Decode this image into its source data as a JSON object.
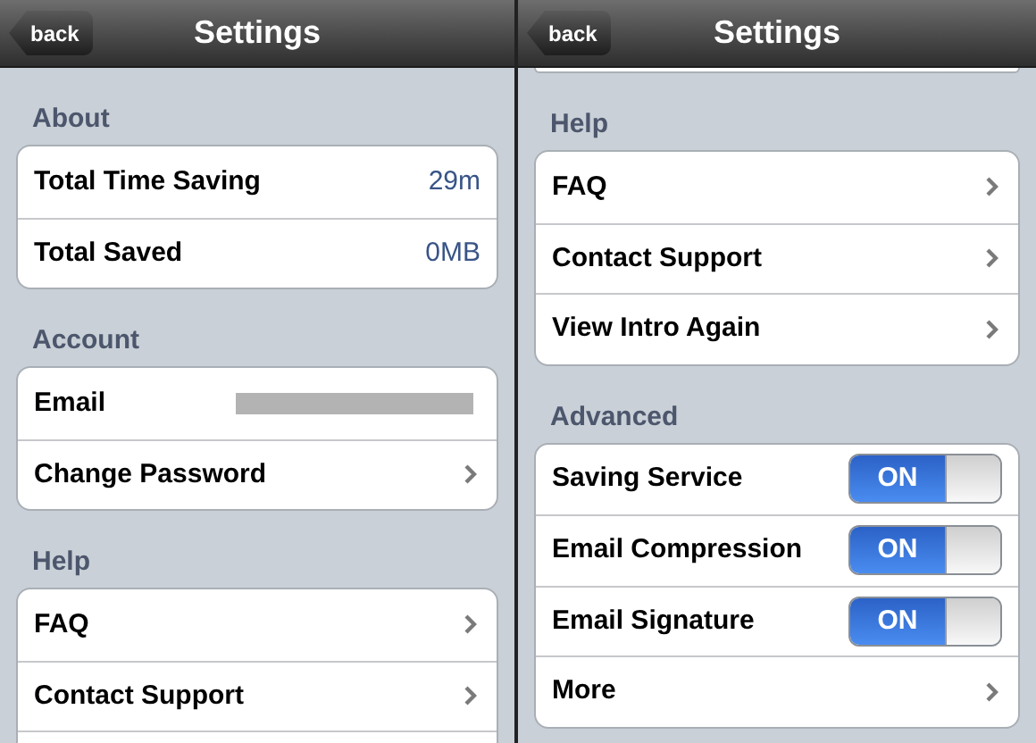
{
  "screens": [
    {
      "title": "Settings",
      "back": "back",
      "cut_group_above": false,
      "sections": [
        {
          "header": "About",
          "rows": [
            {
              "kind": "value",
              "label": "Total Time Saving",
              "value": "29m"
            },
            {
              "kind": "value",
              "label": "Total Saved",
              "value": "0MB"
            }
          ]
        },
        {
          "header": "Account",
          "rows": [
            {
              "kind": "redacted",
              "label": "Email"
            },
            {
              "kind": "link",
              "label": "Change Password"
            }
          ]
        },
        {
          "header": "Help",
          "rows": [
            {
              "kind": "link",
              "label": "FAQ"
            },
            {
              "kind": "link",
              "label": "Contact Support"
            },
            {
              "kind": "blank"
            }
          ]
        }
      ]
    },
    {
      "title": "Settings",
      "back": "back",
      "cut_group_above": true,
      "sections": [
        {
          "header": "Help",
          "rows": [
            {
              "kind": "link",
              "label": "FAQ"
            },
            {
              "kind": "link",
              "label": "Contact Support"
            },
            {
              "kind": "link",
              "label": "View Intro Again"
            }
          ]
        },
        {
          "header": "Advanced",
          "rows": [
            {
              "kind": "toggle",
              "label": "Saving Service",
              "on": true,
              "state_text": "ON"
            },
            {
              "kind": "toggle",
              "label": "Email Compression",
              "on": true,
              "state_text": "ON"
            },
            {
              "kind": "toggle",
              "label": "Email Signature",
              "on": true,
              "state_text": "ON"
            },
            {
              "kind": "link",
              "label": "More"
            }
          ]
        }
      ]
    }
  ]
}
